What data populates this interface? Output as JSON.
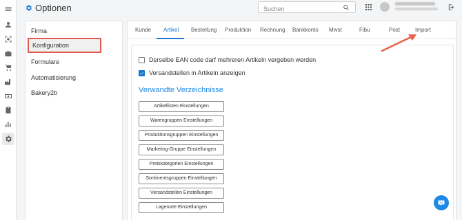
{
  "header": {
    "title": "Optionen",
    "search_placeholder": "Suchen"
  },
  "rail_icons": [
    "menu-icon",
    "user-icon",
    "scan-icon",
    "briefcase-icon",
    "cart-icon",
    "factory-icon",
    "money-icon",
    "clipboard-icon",
    "bar-chart-icon",
    "settings-icon"
  ],
  "sidebar": {
    "items": [
      {
        "label": "Firma"
      },
      {
        "label": "Konfiguration"
      },
      {
        "label": "Formulare"
      },
      {
        "label": "Automatisierung"
      },
      {
        "label": "Bakery2b"
      }
    ],
    "selected": "Konfiguration"
  },
  "tabs": [
    {
      "label": "Kunde"
    },
    {
      "label": "Artikel"
    },
    {
      "label": "Bestellung"
    },
    {
      "label": "Produktion"
    },
    {
      "label": "Rechnung"
    },
    {
      "label": "Bankkonto"
    },
    {
      "label": "Mwst"
    },
    {
      "label": "Fibu"
    },
    {
      "label": "Post"
    },
    {
      "label": "Import"
    }
  ],
  "active_tab": "Artikel",
  "options": [
    {
      "label": "Derselbe EAN code darf mehreren Artikeln vergeben werden",
      "checked": false
    },
    {
      "label": "Versandstellen in Artikeln anzeigen",
      "checked": true
    }
  ],
  "section": {
    "title": "Verwandte Verzeichnisse",
    "buttons": [
      {
        "label": "Artikellisten Einstellungen"
      },
      {
        "label": "Warengruppen Einstellungen"
      },
      {
        "label": "Produktionsgruppen Einstellungen"
      },
      {
        "label": "Marketing-Gruppe Einstellungen"
      },
      {
        "label": "Preiskategorien Einstellungen"
      },
      {
        "label": "Sortimentsgruppen Einstellungen"
      },
      {
        "label": "Versandstellen Einstellungen"
      },
      {
        "label": "Lagerorte Einstellungen"
      }
    ]
  },
  "colors": {
    "accent": "#1976d2",
    "highlight_box": "#e05a50",
    "arrow": "#e8604c"
  }
}
